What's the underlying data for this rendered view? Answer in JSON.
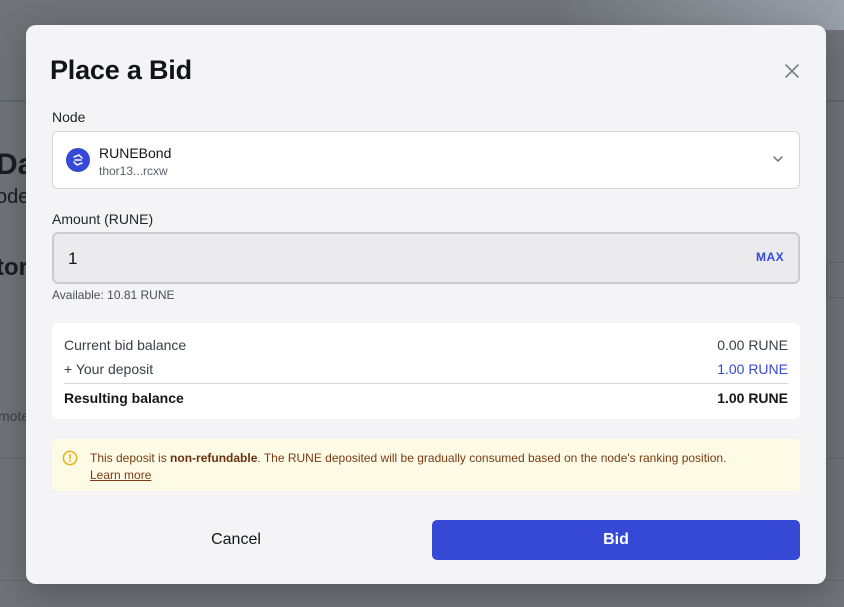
{
  "background": {
    "heading_fragment": "Da",
    "subheading_fragment": "ode",
    "section_fragment": "tor",
    "row_fragment": "mote"
  },
  "modal": {
    "title": "Place a Bid",
    "node": {
      "label": "Node",
      "name": "RUNEBond",
      "address": "thor13...rcxw"
    },
    "amount": {
      "label": "Amount (RUNE)",
      "value": "1",
      "max_label": "MAX",
      "available": "Available: 10.81 RUNE"
    },
    "summary": {
      "rows": [
        {
          "label": "Current bid balance",
          "value": "0.00 RUNE"
        },
        {
          "label": "+ Your deposit",
          "value": "1.00 RUNE"
        },
        {
          "label": "Resulting balance",
          "value": "1.00 RUNE"
        }
      ]
    },
    "warning": {
      "prefix": "This deposit is ",
      "emphasis": "non-refundable",
      "suffix": ". The RUNE deposited will be gradually consumed based on the node's ranking position.",
      "link": "Learn more"
    },
    "buttons": {
      "cancel": "Cancel",
      "bid": "Bid"
    }
  },
  "colors": {
    "accent": "#3549d6",
    "warning_bg": "#fdfbe5",
    "warning_text": "#7a3b12",
    "warning_icon": "#e8b21a"
  }
}
